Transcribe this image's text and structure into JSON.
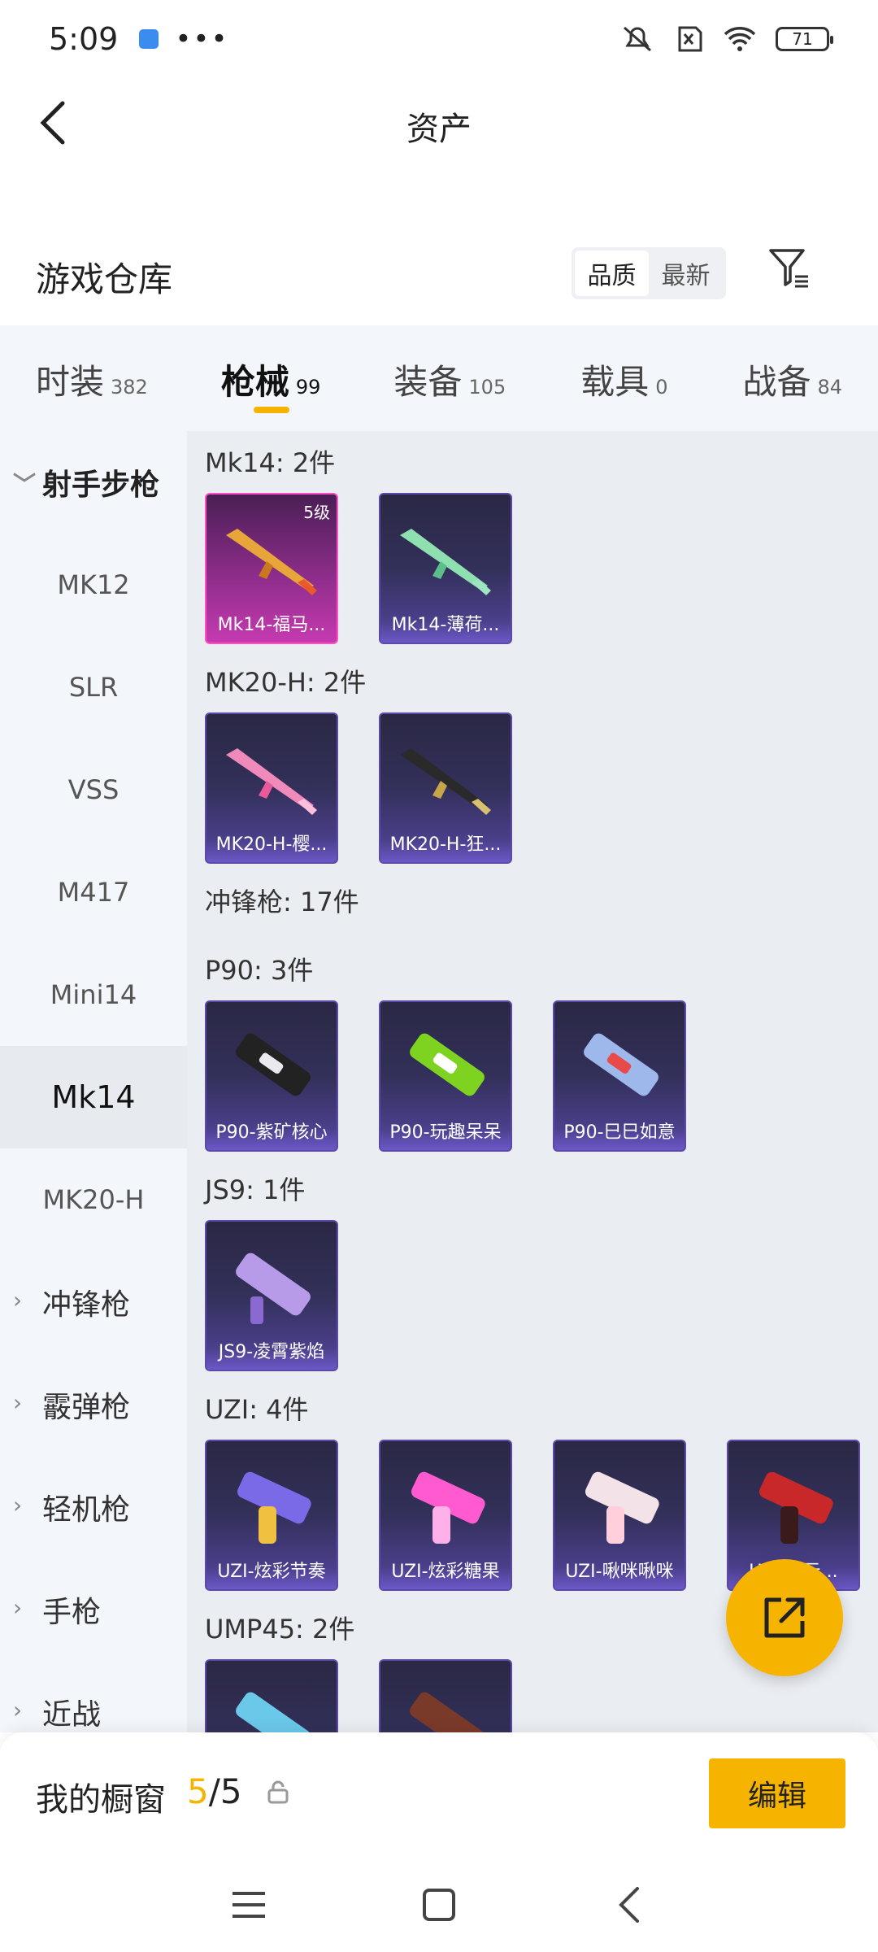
{
  "status_bar": {
    "time": "5:09",
    "more": "•••",
    "battery": "71"
  },
  "header": {
    "title": "资产"
  },
  "warehouse": {
    "title": "游戏仓库",
    "sort_options": [
      "品质",
      "最新"
    ],
    "active_sort": "品质"
  },
  "tabs": [
    {
      "label": "时装",
      "count": "382"
    },
    {
      "label": "枪械",
      "count": "99"
    },
    {
      "label": "装备",
      "count": "105"
    },
    {
      "label": "载具",
      "count": "0"
    },
    {
      "label": "战备",
      "count": "84"
    }
  ],
  "sidenav": {
    "sections": [
      {
        "label": "射手步枪",
        "expanded": true
      },
      {
        "label": "MK12"
      },
      {
        "label": "SLR"
      },
      {
        "label": "VSS"
      },
      {
        "label": "M417"
      },
      {
        "label": "Mini14"
      },
      {
        "label": "Mk14",
        "active": true
      },
      {
        "label": "MK20-H"
      },
      {
        "label": "冲锋枪"
      },
      {
        "label": "霰弹枪"
      },
      {
        "label": "轻机枪"
      },
      {
        "label": "手枪"
      },
      {
        "label": "近战"
      }
    ]
  },
  "groups": [
    {
      "title": "Mk14: 2件",
      "items": [
        {
          "name": "Mk14-福马...",
          "level": "5级"
        },
        {
          "name": "Mk14-薄荷..."
        }
      ]
    },
    {
      "title": "MK20-H: 2件",
      "items": [
        {
          "name": "MK20-H-樱..."
        },
        {
          "name": "MK20-H-狂..."
        }
      ]
    },
    {
      "title": "冲锋枪: 17件",
      "items": []
    },
    {
      "title": "P90: 3件",
      "items": [
        {
          "name": "P90-紫矿核心"
        },
        {
          "name": "P90-玩趣呆呆"
        },
        {
          "name": "P90-巳巳如意"
        }
      ]
    },
    {
      "title": "JS9: 1件",
      "items": [
        {
          "name": "JS9-凌霄紫焰"
        }
      ]
    },
    {
      "title": "UZI: 4件",
      "items": [
        {
          "name": "UZI-炫彩节奏"
        },
        {
          "name": "UZI-炫彩糖果"
        },
        {
          "name": "UZI-啾咪啾咪"
        },
        {
          "name": "UZI-...元..."
        }
      ]
    },
    {
      "title": "UMP45: 2件",
      "items": [
        {
          "name": ""
        },
        {
          "name": ""
        }
      ]
    }
  ],
  "showcase": {
    "label": "我的橱窗",
    "current": "5",
    "sep": "/",
    "total": "5",
    "edit_label": "编辑"
  },
  "colors": {
    "accent": "#f6b400",
    "tile_purple": "#4a3f8a",
    "tile_gold_border": "#ff4fc2"
  }
}
